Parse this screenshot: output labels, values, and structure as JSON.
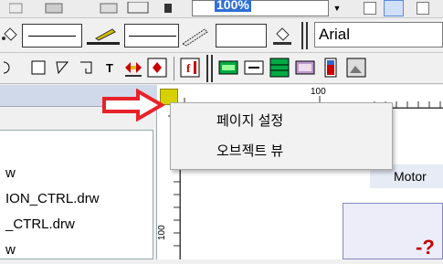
{
  "toolbar_top": {
    "zoom_value": "100%"
  },
  "toolbar_font": {
    "font_name": "Arial"
  },
  "ruler": {
    "top_mark": "100",
    "left_mark": "100"
  },
  "files": [
    "w",
    "ION_CTRL.drw",
    "_CTRL.drw",
    "w"
  ],
  "context_menu": {
    "items": [
      "페이지 설정",
      "오브젝트 뷰"
    ]
  },
  "canvas": {
    "motor_label": "Motor",
    "question_mark": "-?"
  },
  "colors": {
    "arrow": "#e8222a",
    "corner_button": "#d7d000",
    "ruler_strip": "#cfd9ea"
  }
}
